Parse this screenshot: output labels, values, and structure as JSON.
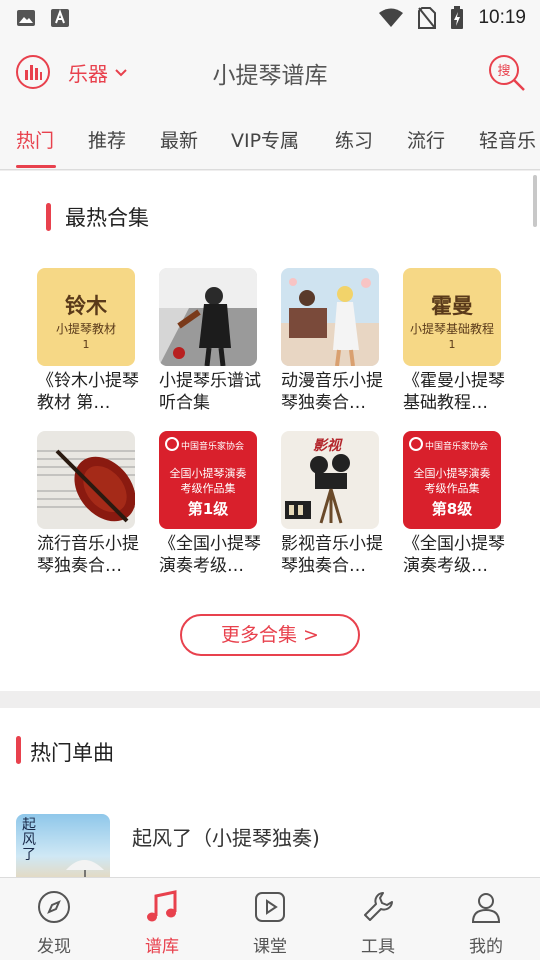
{
  "status_bar": {
    "time": "10:19"
  },
  "header": {
    "instrument": "乐器",
    "title": "小提琴谱库",
    "search_icon_text": "搜"
  },
  "tabs": [
    "热门",
    "推荐",
    "最新",
    "VIP专属",
    "练习",
    "流行",
    "轻音乐"
  ],
  "active_tab": "热门",
  "hot_collections": {
    "title": "最热合集",
    "items": [
      {
        "name": "《铃木小提琴教材 第…",
        "cover": {
          "big": "铃木",
          "mid": "小提琴教材",
          "num": "1"
        }
      },
      {
        "name": "小提琴乐谱试听合集"
      },
      {
        "name": "动漫音乐小提琴独奏合…"
      },
      {
        "name": "《霍曼小提琴基础教程…",
        "cover": {
          "big": "霍曼",
          "mid": "小提琴基础教程",
          "num": "1"
        }
      },
      {
        "name": "流行音乐小提琴独奏合…"
      },
      {
        "name": "《全国小提琴演奏考级…",
        "cover": {
          "assoc": "中国音乐家协会",
          "l1": "全国小提琴演奏",
          "l2": "考级作品集",
          "level": "第1级"
        }
      },
      {
        "name": "影视音乐小提琴独奏合…",
        "cover": {
          "ying": "影视"
        }
      },
      {
        "name": "《全国小提琴演奏考级…",
        "cover": {
          "assoc": "中国音乐家协会",
          "l1": "全国小提琴演奏",
          "l2": "考级作品集",
          "level": "第8级"
        }
      }
    ],
    "more_label": "更多合集 >"
  },
  "hot_singles": {
    "title": "热门单曲",
    "items": [
      {
        "title": "起风了（小提琴独奏)",
        "cover_text": "起风了"
      }
    ]
  },
  "bottom_nav": [
    "发现",
    "谱库",
    "课堂",
    "工具",
    "我的"
  ],
  "active_nav": "谱库",
  "colors": {
    "accent": "#e8414d",
    "background": "#efeeee",
    "card": "#ffffff"
  }
}
